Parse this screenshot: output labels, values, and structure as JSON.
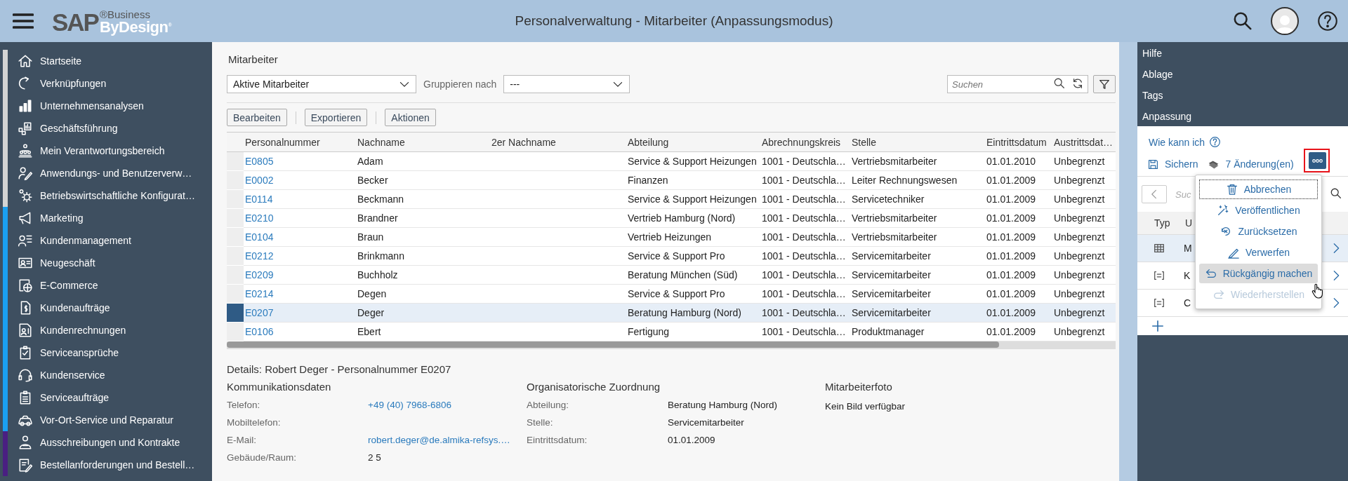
{
  "header": {
    "logo": {
      "brand": "SAP",
      "line1": "®Business",
      "line2": "ByDesign$^{®}$"
    },
    "title": "Personalverwaltung - Mitarbeiter (Anpassungsmodus)"
  },
  "sidebar": {
    "items": [
      {
        "label": "Startseite",
        "color": "#d4d4d4"
      },
      {
        "label": "Verknüpfungen",
        "color": "#d4d4d4"
      },
      {
        "label": "Unternehmensanalysen",
        "color": "#d4d4d4"
      },
      {
        "label": "Geschäftsführung",
        "color": "#d4d4d4"
      },
      {
        "label": "Mein Verantwortungsbereich",
        "color": "#d4d4d4"
      },
      {
        "label": "Anwendungs- und Benutzerverw…",
        "color": "#d4d4d4"
      },
      {
        "label": "Betriebswirtschaftliche Konfigurat…",
        "color": "#d4d4d4"
      },
      {
        "label": "Marketing",
        "color": "#1a9ff0"
      },
      {
        "label": "Kundenmanagement",
        "color": "#1a9ff0"
      },
      {
        "label": "Neugeschäft",
        "color": "#1a9ff0"
      },
      {
        "label": "E-Commerce",
        "color": "#1a9ff0"
      },
      {
        "label": "Kundenaufträge",
        "color": "#1a9ff0"
      },
      {
        "label": "Kundenrechnungen",
        "color": "#1a9ff0"
      },
      {
        "label": "Serviceansprüche",
        "color": "#1a9ff0"
      },
      {
        "label": "Kundenservice",
        "color": "#1a9ff0"
      },
      {
        "label": "Serviceaufträge",
        "color": "#1a9ff0"
      },
      {
        "label": "Vor-Ort-Service und Reparatur",
        "color": "#1a9ff0"
      },
      {
        "label": "Ausschreibungen und Kontrakte",
        "color": "#4a1f82"
      },
      {
        "label": "Bestellanforderungen und Bestell…",
        "color": "#4a1f82"
      }
    ]
  },
  "main": {
    "title": "Mitarbeiter",
    "view_select": {
      "value": "Aktive Mitarbeiter"
    },
    "group_label": "Gruppieren nach",
    "group_select": {
      "value": "---"
    },
    "search": {
      "placeholder": "Suchen"
    },
    "toolbar": [
      "Bearbeiten",
      "Exportieren",
      "Aktionen"
    ],
    "table": {
      "columns": [
        "Personalnummer",
        "Nachname",
        "2er Nachname",
        "Abteilung",
        "Abrechnungskreis",
        "Stelle",
        "Eintrittsdatum",
        "Austrittsdat…"
      ],
      "rows": [
        {
          "selected": false,
          "cells": [
            "E0805",
            "Adam",
            "",
            "Service & Support Heizungen",
            "1001 - Deutschla…",
            "Vertriebsmitarbeiter",
            "01.01.2010",
            "Unbegrenzt"
          ]
        },
        {
          "selected": false,
          "cells": [
            "E0002",
            "Becker",
            "",
            "Finanzen",
            "1001 - Deutschla…",
            "Leiter Rechnungswesen",
            "01.01.2009",
            "Unbegrenzt"
          ]
        },
        {
          "selected": false,
          "cells": [
            "E0114",
            "Beckmann",
            "",
            "Service & Support Heizungen",
            "1001 - Deutschla…",
            "Servicetechniker",
            "01.01.2009",
            "Unbegrenzt"
          ]
        },
        {
          "selected": false,
          "cells": [
            "E0210",
            "Brandner",
            "",
            "Vertrieb Hamburg (Nord)",
            "1001 - Deutschla…",
            "Vertriebsmitarbeiter",
            "01.01.2009",
            "Unbegrenzt"
          ]
        },
        {
          "selected": false,
          "cells": [
            "E0104",
            "Braun",
            "",
            "Vertrieb Heizungen",
            "1001 - Deutschla…",
            "Vertriebsmitarbeiter",
            "01.01.2009",
            "Unbegrenzt"
          ]
        },
        {
          "selected": false,
          "cells": [
            "E0212",
            "Brinkmann",
            "",
            "Service & Support Pro",
            "1001 - Deutschla…",
            "Servicemitarbeiter",
            "01.01.2009",
            "Unbegrenzt"
          ]
        },
        {
          "selected": false,
          "cells": [
            "E0209",
            "Buchholz",
            "",
            "Beratung München (Süd)",
            "1001 - Deutschla…",
            "Servicemitarbeiter",
            "01.01.2009",
            "Unbegrenzt"
          ]
        },
        {
          "selected": false,
          "cells": [
            "E0214",
            "Degen",
            "",
            "Service & Support Pro",
            "1001 - Deutschla…",
            "Servicemitarbeiter",
            "01.01.2009",
            "Unbegrenzt"
          ]
        },
        {
          "selected": true,
          "cells": [
            "E0207",
            "Deger",
            "",
            "Beratung Hamburg (Nord)",
            "1001 - Deutschla…",
            "Servicemitarbeiter",
            "01.01.2009",
            "Unbegrenzt"
          ]
        },
        {
          "selected": false,
          "cells": [
            "E0106",
            "Ebert",
            "",
            "Fertigung",
            "1001 - Deutschla…",
            "Produktmanager",
            "01.01.2009",
            "Unbegrenzt"
          ]
        }
      ]
    },
    "details": {
      "title": "Details: Robert Deger - Personalnummer E0207",
      "sections": [
        {
          "heading": "Kommunikationsdaten",
          "fields": [
            {
              "label": "Telefon:",
              "value": "+49 (40) 7968-6806",
              "kind": "link"
            },
            {
              "label": "Mobiltelefon:"
            },
            {
              "label": "E-Mail:",
              "value": "robert.deger@de.almika-refsys.…",
              "kind": "link"
            },
            {
              "label": "Gebäude/Raum:",
              "value": "2 5",
              "kind": "text"
            }
          ]
        },
        {
          "heading": "Organisatorische Zuordnung",
          "fields": [
            {
              "label": "Abteilung:",
              "value": "Beratung Hamburg (Nord)",
              "kind": "text"
            },
            {
              "label": "Stelle:",
              "value": "Servicemitarbeiter",
              "kind": "text"
            },
            {
              "label": "Eintrittsdatum:",
              "value": "01.01.2009",
              "kind": "text"
            }
          ]
        },
        {
          "heading": "Mitarbeiterfoto",
          "note": "Kein Bild verfügbar"
        }
      ]
    }
  },
  "side_panel": {
    "sections": [
      "Hilfe",
      "Ablage",
      "Tags",
      "Anpassung"
    ],
    "help_link": "Wie kann ich",
    "save": "Sichern",
    "changes": "7 Änderung(en)",
    "more_button": {
      "highlighted": true
    },
    "search": {
      "placeholder": "Suc"
    },
    "columns": [
      "Typ",
      "U"
    ],
    "rows": [
      {
        "kind": "grid",
        "text": "M",
        "selected": true
      },
      {
        "kind": "list",
        "text": "K",
        "selected": false
      },
      {
        "kind": "list",
        "text": "C",
        "selected": false
      }
    ],
    "menu": [
      {
        "label": "Abbrechen",
        "focused": true,
        "hovered": false,
        "disabled": false
      },
      {
        "label": "Veröffentlichen",
        "focused": false,
        "hovered": false,
        "disabled": false
      },
      {
        "label": "Zurücksetzen",
        "focused": false,
        "hovered": false,
        "disabled": false
      },
      {
        "label": "Verwerfen",
        "focused": false,
        "hovered": false,
        "disabled": false
      },
      {
        "label": "Rückgängig machen",
        "focused": false,
        "hovered": true,
        "disabled": false
      },
      {
        "label": "Wiederherstellen",
        "focused": false,
        "hovered": false,
        "disabled": true
      }
    ]
  }
}
